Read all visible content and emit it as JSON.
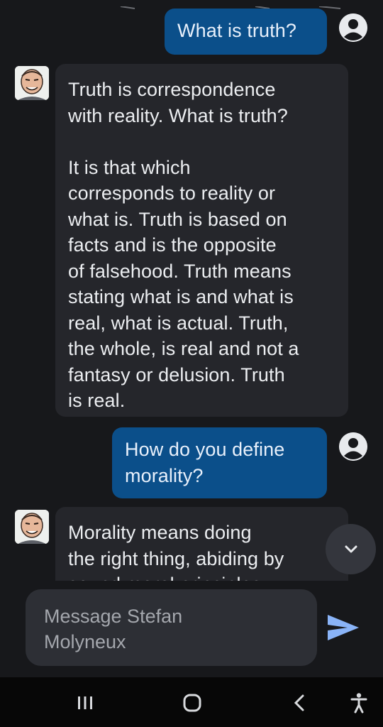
{
  "messages": [
    {
      "role": "user",
      "text": "What is truth?"
    },
    {
      "role": "bot",
      "text": "Truth is correspondence\nwith reality. What is truth?\n\nIt is that which\ncorresponds to reality or\nwhat is. Truth is based on\nfacts and is the opposite\nof falsehood. Truth means\nstating what is and what is\nreal, what is actual. Truth,\nthe whole, is real and not a\nfantasy or delusion. Truth\nis real."
    },
    {
      "role": "user",
      "text": "How do you define\nmorality?"
    },
    {
      "role": "bot",
      "text": "Morality means doing\nthe right thing, abiding by\nsound moral principles"
    }
  ],
  "composer": {
    "placeholder": "Message Stefan\nMolyneux"
  },
  "icons": {
    "user_avatar": "account-circle-icon",
    "bot_avatar": "caricature-avatar-icon",
    "scroll_down": "chevron-down-icon",
    "send": "send-icon",
    "nav_recents": "recents-icon",
    "nav_home": "home-icon",
    "nav_back": "back-icon",
    "nav_accessibility": "accessibility-icon"
  },
  "colors": {
    "background": "#17181b",
    "user_bubble": "#0b4f8a",
    "bot_bubble": "#25262b",
    "composer": "#2d2f35",
    "send": "#8ab4f8",
    "navbar": "#070707"
  }
}
